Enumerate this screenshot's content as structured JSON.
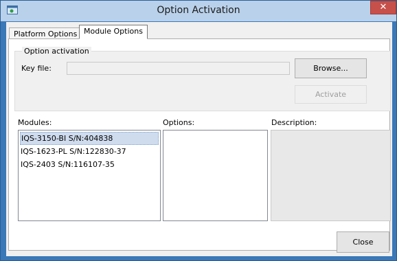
{
  "window": {
    "title": "Option Activation",
    "close_glyph": "✕"
  },
  "tabs": [
    {
      "label": "Platform Options"
    },
    {
      "label": "Module Options"
    }
  ],
  "activation_group": {
    "title": "Option activation",
    "key_file_label": "Key file:",
    "key_file_value": "",
    "browse_label": "Browse...",
    "activate_label": "Activate"
  },
  "columns": {
    "modules_label": "Modules:",
    "options_label": "Options:",
    "description_label": "Description:"
  },
  "modules": [
    {
      "label": "IQS-3150-BI S/N:404838",
      "selected": true
    },
    {
      "label": "IQS-1623-PL S/N:122830-37",
      "selected": false
    },
    {
      "label": "IQS-2403 S/N:116107-35",
      "selected": false
    }
  ],
  "footer": {
    "close_label": "Close"
  },
  "colors": {
    "titlebar": "#b9d1ea",
    "frame": "#3a78b8",
    "close_button": "#c7504a",
    "selection": "#cfdcee"
  },
  "icons": {
    "app": "window-app-icon",
    "close": "close-icon"
  }
}
